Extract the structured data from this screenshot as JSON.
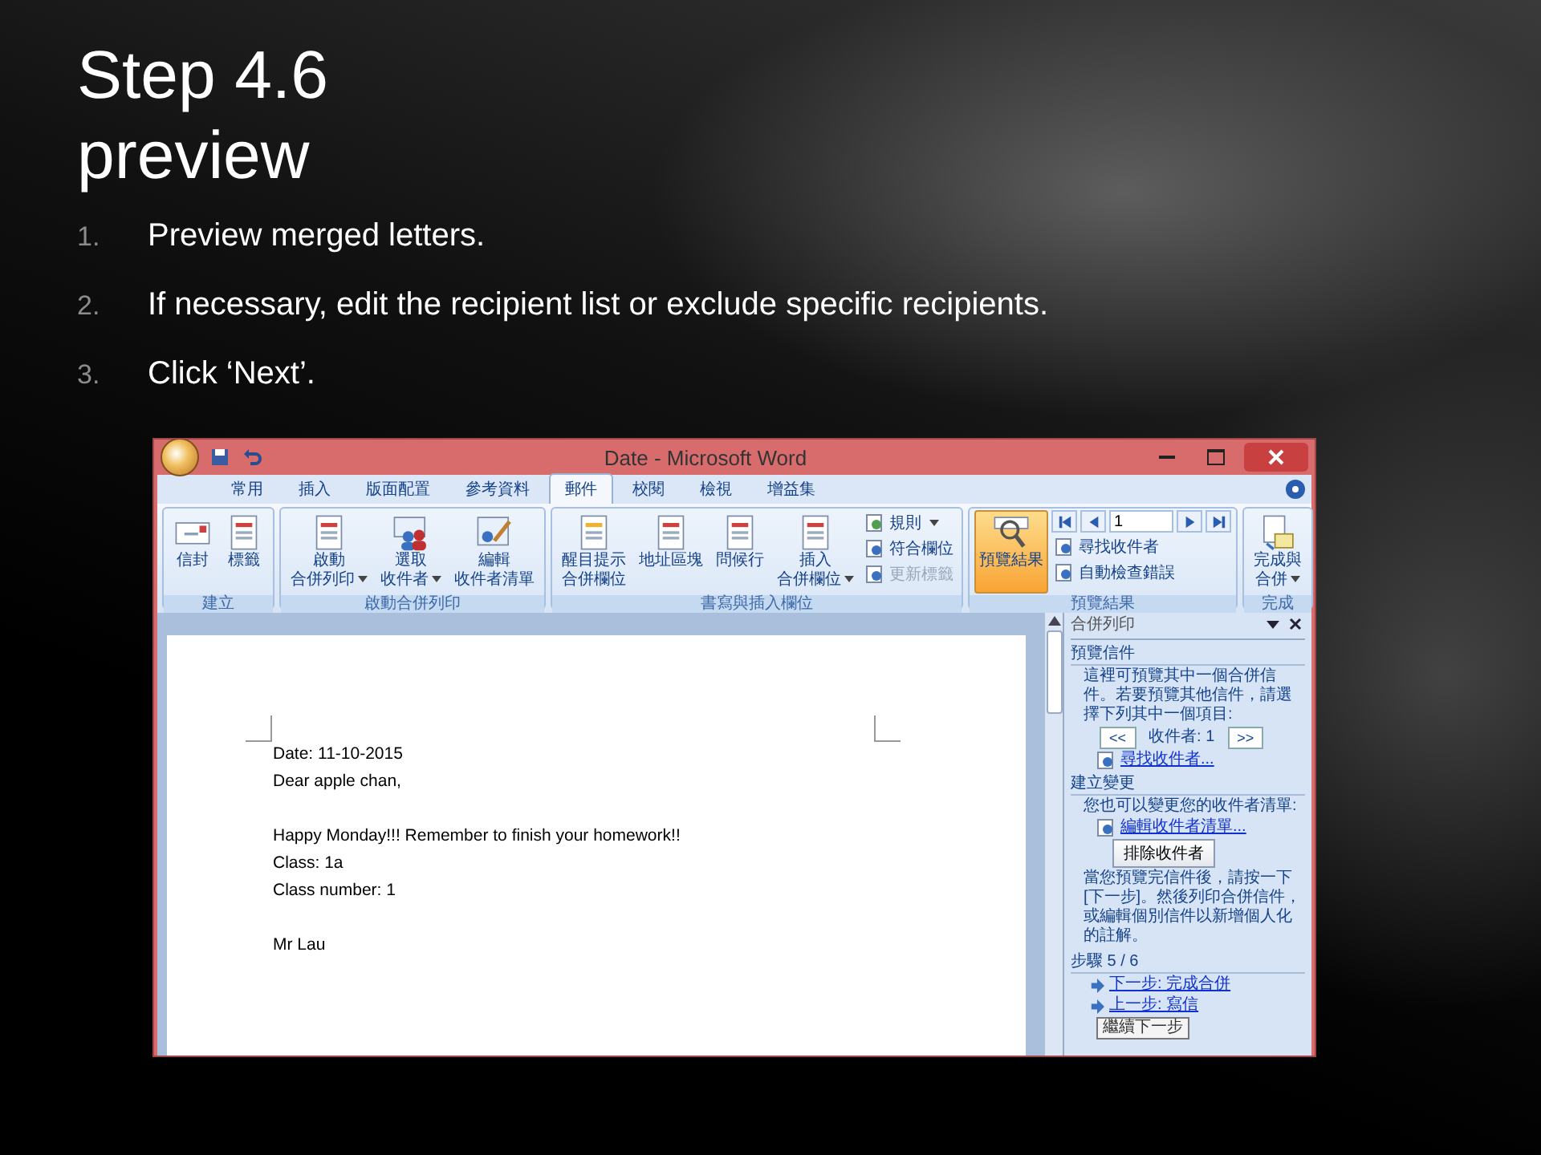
{
  "slide": {
    "title_lines": [
      "Step 4.6",
      "preview"
    ],
    "steps": [
      {
        "number": "1.",
        "text": "Preview merged letters."
      },
      {
        "number": "2.",
        "text": "If necessary, edit the recipient list or exclude specific recipients."
      },
      {
        "number": "3.",
        "text": "Click ‘Next’."
      }
    ]
  },
  "window": {
    "title": "Date - Microsoft Word"
  },
  "tabs": [
    {
      "label": "常用",
      "selected": false
    },
    {
      "label": "插入",
      "selected": false
    },
    {
      "label": "版面配置",
      "selected": false
    },
    {
      "label": "參考資料",
      "selected": false
    },
    {
      "label": "郵件",
      "selected": true
    },
    {
      "label": "校閱",
      "selected": false
    },
    {
      "label": "檢視",
      "selected": false
    },
    {
      "label": "增益集",
      "selected": false
    }
  ],
  "ribbon_groups": [
    {
      "label": "建立",
      "items": [
        {
          "kind": "large",
          "lines": [
            "信封"
          ],
          "dropdown": false,
          "selected": false
        },
        {
          "kind": "large",
          "lines": [
            "標籤"
          ],
          "dropdown": false,
          "selected": false
        }
      ]
    },
    {
      "label": "啟動合併列印",
      "items": [
        {
          "kind": "large",
          "lines": [
            "啟動",
            "合併列印"
          ],
          "dropdown": true,
          "selected": false
        },
        {
          "kind": "large",
          "lines": [
            "選取",
            "收件者"
          ],
          "dropdown": true,
          "selected": false
        },
        {
          "kind": "large",
          "lines": [
            "編輯",
            "收件者清單"
          ],
          "dropdown": false,
          "selected": false
        }
      ]
    },
    {
      "label": "書寫與插入欄位",
      "items": [
        {
          "kind": "large",
          "lines": [
            "醒目提示",
            "合併欄位"
          ],
          "dropdown": false,
          "selected": false
        },
        {
          "kind": "large",
          "lines": [
            "地址區塊"
          ],
          "dropdown": false,
          "selected": false
        },
        {
          "kind": "large",
          "lines": [
            "問候行"
          ],
          "dropdown": false,
          "selected": false
        },
        {
          "kind": "large",
          "lines": [
            "插入",
            "合併欄位"
          ],
          "dropdown": true,
          "selected": false
        },
        {
          "kind": "column",
          "items": [
            {
              "kind": "small",
              "label": "規則",
              "dropdown": true,
              "disabled": false
            },
            {
              "kind": "small",
              "label": "符合欄位",
              "dropdown": false,
              "disabled": false
            },
            {
              "kind": "small",
              "label": "更新標籤",
              "dropdown": false,
              "disabled": true
            }
          ]
        }
      ]
    },
    {
      "label": "預覽結果",
      "items": [
        {
          "kind": "large",
          "lines": [
            "預覽結果"
          ],
          "dropdown": false,
          "selected": true
        },
        {
          "kind": "column",
          "items": [
            {
              "kind": "record_nav",
              "value": "1"
            },
            {
              "kind": "small",
              "label": "尋找收件者",
              "dropdown": false,
              "disabled": false
            },
            {
              "kind": "small",
              "label": "自動檢查錯誤",
              "dropdown": false,
              "disabled": false
            }
          ]
        }
      ]
    },
    {
      "label": "完成",
      "items": [
        {
          "kind": "large",
          "lines": [
            "完成與",
            "合併"
          ],
          "dropdown": true,
          "selected": false
        }
      ]
    }
  ],
  "document": {
    "paragraphs": [
      {
        "lines": [
          "Date: 11-10-2015",
          "Dear apple chan,"
        ]
      },
      {
        "lines": [
          "Happy Monday!!! Remember to finish your homework!!",
          "Class: 1a",
          "Class number: 1"
        ]
      },
      {
        "lines": [
          "Mr Lau"
        ]
      }
    ]
  },
  "task_pane": {
    "title": "合併列印",
    "items": [
      {
        "kind": "heading",
        "text": "預覽信件"
      },
      {
        "kind": "text",
        "text": "這裡可預覽其中一個合併信件。若要預覽其他信件，請選擇下列其中一個項目:"
      },
      {
        "kind": "recipient_nav",
        "prev": "<<",
        "label": "收件者: 1",
        "next": ">>"
      },
      {
        "kind": "link",
        "text": "尋找收件者..."
      },
      {
        "kind": "heading",
        "text": "建立變更"
      },
      {
        "kind": "text",
        "text": "您也可以變更您的收件者清單:"
      },
      {
        "kind": "link",
        "text": "編輯收件者清單..."
      },
      {
        "kind": "button",
        "text": "排除收件者"
      },
      {
        "kind": "text",
        "text": "當您預覽完信件後，請按一下 [下一步]。然後列印合併信件，或編輯個別信件以新增個人化的註解。"
      },
      {
        "kind": "step",
        "text": "步驟 5 / 6"
      },
      {
        "kind": "step_link",
        "text": "下一步: 完成合併"
      },
      {
        "kind": "step_link",
        "text": "上一步: 寫信"
      }
    ],
    "tooltip": "繼續下一步"
  }
}
